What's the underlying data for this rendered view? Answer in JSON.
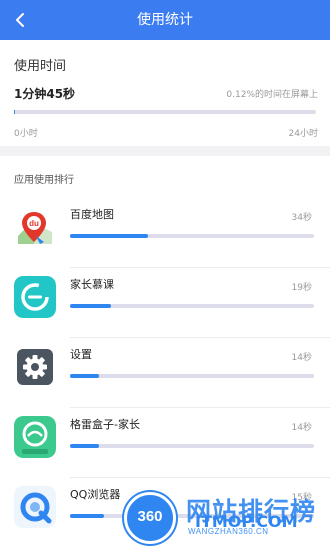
{
  "header": {
    "title": "使用统计",
    "back_icon": "chevron-left-icon"
  },
  "usage": {
    "heading": "使用时间",
    "duration": "1分钟45秒",
    "percent_text": "0.12%的时间在屏幕上",
    "progress_fraction": 0.0012,
    "scale_min": "0小时",
    "scale_max": "24小时"
  },
  "ranking": {
    "heading": "应用使用排行",
    "apps": [
      {
        "name": "百度地图",
        "time": "34秒",
        "usage_fraction": 0.32,
        "icon": "baidu-map-icon"
      },
      {
        "name": "家长慕课",
        "time": "19秒",
        "usage_fraction": 0.17,
        "icon": "parent-mooc-icon"
      },
      {
        "name": "设置",
        "time": "14秒",
        "usage_fraction": 0.12,
        "icon": "settings-gear-icon"
      },
      {
        "name": "格雷盒子-家长",
        "time": "14秒",
        "usage_fraction": 0.12,
        "icon": "gelei-box-icon"
      },
      {
        "name": "QQ浏览器",
        "time": "15秒",
        "usage_fraction": 0.14,
        "icon": "qq-browser-icon"
      }
    ]
  },
  "watermark": {
    "logo_number": "360",
    "title": "网站排行榜",
    "url": "WANGZHAN360.CN",
    "brand": "ITMOP.COM"
  },
  "colors": {
    "accent": "#3b7cf0",
    "bar_fill": "#2f86f0",
    "track": "#dcdcea"
  }
}
